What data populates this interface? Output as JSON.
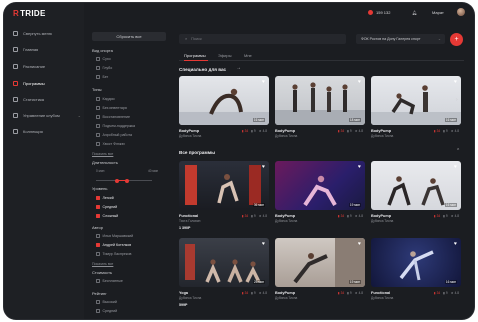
{
  "app": {
    "logo": "TRIDE"
  },
  "topbar": {
    "balance_icon": "coin-icon",
    "balance": "159 132",
    "username": "Марат",
    "bell_icon": "bell-icon"
  },
  "nav": {
    "items": [
      {
        "label": "Свернуть меню",
        "icon": "collapse-icon"
      },
      {
        "label": "Главная",
        "icon": "home-icon"
      },
      {
        "label": "Расписание",
        "icon": "calendar-icon"
      },
      {
        "label": "Программы",
        "icon": "programs-icon"
      },
      {
        "label": "Статистика",
        "icon": "stats-icon"
      },
      {
        "label": "Управление клубом",
        "icon": "club-icon"
      },
      {
        "label": "Коллекция",
        "icon": "collection-icon"
      }
    ]
  },
  "filters": {
    "reset_label": "Сбросить все",
    "sport_head": "Вид спорта",
    "sport": [
      "Сухо",
      "Глубо",
      "Бег"
    ],
    "type_head": "Типы",
    "type": [
      "Кардио",
      "Без инвентаря",
      "Восстановление",
      "Подъем-поддержка",
      "Аэробный работа",
      "Хвост Флэкэх"
    ],
    "more1": "Показать все",
    "duration_head": "Длительность",
    "duration_min": "0 мин",
    "duration_max": "40 мин",
    "level_head": "Уровень",
    "levels": [
      {
        "label": "Легкий",
        "on": true
      },
      {
        "label": "Средний",
        "on": true
      },
      {
        "label": "Сложный",
        "on": true
      }
    ],
    "author_head": "Автор",
    "authors": [
      {
        "label": "Илья Маршавский",
        "on": false
      },
      {
        "label": "Андрей Котелков",
        "on": true
      },
      {
        "label": "Тимур Ласпреков",
        "on": false
      }
    ],
    "more2": "Показать все",
    "cost_head": "Стоимость",
    "cost_val": "Бесплатные",
    "rating_head": "Рейтинг",
    "rating": [
      "Высокий",
      "Средний"
    ]
  },
  "search": {
    "placeholder": "Поиск",
    "search_icon": "search-icon"
  },
  "club": {
    "label": "ФОК Ростов на Дону Галерея спорт"
  },
  "add": {
    "label": "+"
  },
  "tabs": [
    "Программы",
    "Эфиры",
    "Мне"
  ],
  "sections": {
    "special": "Специально для вас",
    "all": "Все программы"
  },
  "special_cards": [
    {
      "name": "BodyPump",
      "meta": "Дубинка Тиона",
      "dur": "16 мин",
      "tag1": "34",
      "tag2": "9",
      "rating": "4.8"
    },
    {
      "name": "BodyPump",
      "meta": "Дубинка Тиона",
      "dur": "18 мин",
      "tag1": "34",
      "tag2": "9",
      "rating": "4.8"
    },
    {
      "name": "BodyPump",
      "meta": "Дубинка Тиона",
      "dur": "16 мин",
      "tag1": "34",
      "tag2": "9",
      "rating": "4.8"
    }
  ],
  "all_cards": [
    {
      "name": "Functional",
      "meta": "Тиста Головин",
      "dur": "36 мин",
      "price": "1 390Р",
      "tag1": "34",
      "tag2": "9",
      "rating": "4.8"
    },
    {
      "name": "BodyPump",
      "meta": "Дубинка Тиона",
      "dur": "19 мин",
      "price": "",
      "tag1": "34",
      "tag2": "9",
      "rating": "4.8"
    },
    {
      "name": "BodyPump",
      "meta": "Дубинка Тиона",
      "dur": "16 мин",
      "price": "",
      "tag1": "34",
      "tag2": "9",
      "rating": "4.8"
    },
    {
      "name": "Yoga",
      "meta": "Дубинка Тиона",
      "dur": "25 мин",
      "price": "599Р",
      "tag1": "34",
      "tag2": "9",
      "rating": "4.8"
    },
    {
      "name": "BodyPump",
      "meta": "Дубинка Тиона",
      "dur": "19 мин",
      "price": "",
      "tag1": "34",
      "tag2": "9",
      "rating": "4.8"
    },
    {
      "name": "Functional",
      "meta": "Дубинка Тиона",
      "dur": "16 мин",
      "price": "",
      "tag1": "34",
      "tag2": "9",
      "rating": "4.8"
    }
  ]
}
